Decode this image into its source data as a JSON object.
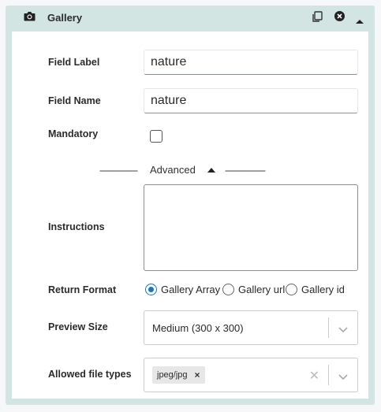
{
  "header": {
    "title": "Gallery",
    "icons": [
      "camera-icon",
      "duplicate-icon",
      "close-circle-icon",
      "collapse-up-icon"
    ]
  },
  "fields": {
    "field_label": {
      "label": "Field Label",
      "value": "nature"
    },
    "field_name": {
      "label": "Field Name",
      "value": "nature"
    },
    "mandatory": {
      "label": "Mandatory",
      "checked": false
    },
    "advanced": {
      "label": "Advanced",
      "left_dashes": "----------------",
      "right_dashes": "-----------------"
    },
    "instructions": {
      "label": "Instructions",
      "value": ""
    },
    "return_format": {
      "label": "Return Format",
      "options": [
        "Gallery Array",
        "Gallery url",
        "Gallery id"
      ],
      "selected": "Gallery Array"
    },
    "preview_size": {
      "label": "Preview Size",
      "value": "Medium (300 x 300)"
    },
    "allowed_file_types": {
      "label": "Allowed file types",
      "tags": [
        "jpeg/jpg"
      ]
    }
  },
  "colors": {
    "accent": "#1e73be",
    "panel_bg": "#d2e5e2"
  }
}
